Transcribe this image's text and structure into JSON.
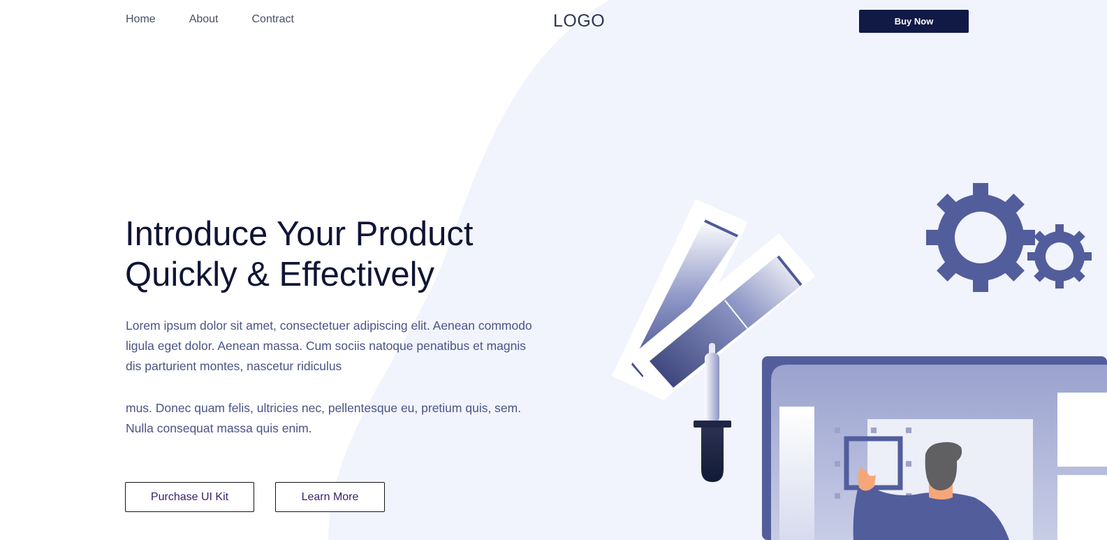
{
  "nav": {
    "items": [
      {
        "label": "Home"
      },
      {
        "label": "About"
      },
      {
        "label": "Contract"
      }
    ]
  },
  "logo": "LOGO",
  "header": {
    "cta_label": "Buy Now"
  },
  "hero": {
    "title_line1": "Introduce Your Product",
    "title_line2": "Quickly & Effectively",
    "paragraph1": "Lorem ipsum dolor sit amet, consectetuer adipiscing elit. Aenean commodo ligula eget dolor. Aenean massa. Cum sociis natoque penatibus et magnis dis parturient montes, nascetur ridiculus",
    "paragraph2": "mus. Donec quam felis, ultricies nec, pellentesque eu, pretium quis, sem. Nulla consequat massa quis enim.",
    "primary_button": "Purchase UI Kit",
    "secondary_button": "Learn More"
  },
  "colors": {
    "accent_dark": "#111a45",
    "accent_blue": "#525d9c",
    "background_blob": "#f1f4fc",
    "body_text": "#4a5486"
  },
  "illustration": {
    "icons": [
      "gear-icon",
      "color-swatch-icon",
      "eyedropper-icon",
      "monitor-icon",
      "person-icon"
    ]
  }
}
